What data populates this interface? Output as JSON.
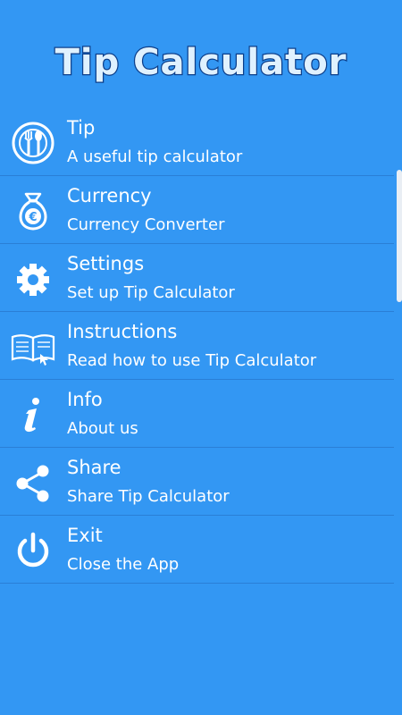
{
  "app": {
    "title": "Tip Calculator"
  },
  "menu": {
    "items": [
      {
        "title": "Tip",
        "subtitle": "A useful tip calculator",
        "icon": "fork-spoon-plate-icon"
      },
      {
        "title": "Currency",
        "subtitle": "Currency Converter",
        "icon": "euro-money-bag-icon"
      },
      {
        "title": "Settings",
        "subtitle": "Set up Tip Calculator",
        "icon": "gear-icon"
      },
      {
        "title": "Instructions",
        "subtitle": "Read how to use Tip Calculator",
        "icon": "open-book-icon"
      },
      {
        "title": "Info",
        "subtitle": "About us",
        "icon": "info-icon"
      },
      {
        "title": "Share",
        "subtitle": "Share Tip Calculator",
        "icon": "share-icon"
      },
      {
        "title": "Exit",
        "subtitle": "Close the App",
        "icon": "power-icon"
      }
    ]
  },
  "colors": {
    "background": "#3397f3",
    "divider": "#2a7fd6",
    "text": "#ffffff",
    "title_fill": "#dff1ff",
    "title_outline": "#0d3f8a"
  }
}
